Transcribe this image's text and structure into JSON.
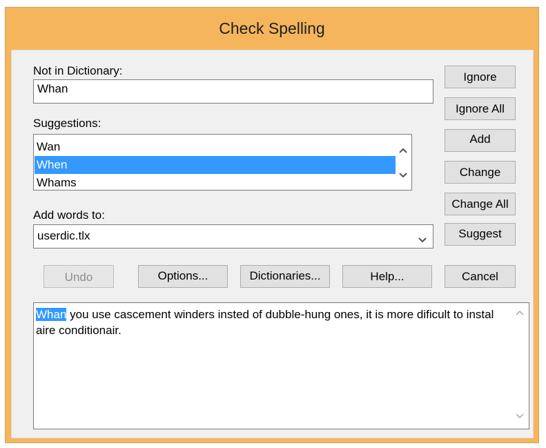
{
  "window": {
    "title": "Check Spelling"
  },
  "not_in_dictionary": {
    "label": "Not in Dictionary:",
    "value": "Whan"
  },
  "suggestions": {
    "label": "Suggestions:",
    "items": [
      "Wan",
      "When",
      "Whams"
    ],
    "selected": "When",
    "scroll_up_icon": "chevron-up-icon",
    "scroll_down_icon": "chevron-down-icon"
  },
  "add_words_to": {
    "label": "Add words to:",
    "value": "userdic.tlx",
    "dropdown_icon": "chevron-down-icon"
  },
  "side_buttons": {
    "ignore": "Ignore",
    "ignore_all": "Ignore All",
    "add": "Add",
    "change": "Change",
    "change_all": "Change All",
    "suggest": "Suggest",
    "cancel": "Cancel"
  },
  "bottom_buttons": {
    "undo": "Undo",
    "options": "Options...",
    "dictionaries": "Dictionaries...",
    "help": "Help..."
  },
  "context": {
    "highlighted_word": "Whan",
    "rest_of_text": " you use cascement winders insted of dubble-hung ones, it is more dificult to instal aire conditionair."
  },
  "colors": {
    "title_bar": "#f5b55c",
    "selection": "#3399ff",
    "dialog_bg": "#f0f0f0"
  }
}
